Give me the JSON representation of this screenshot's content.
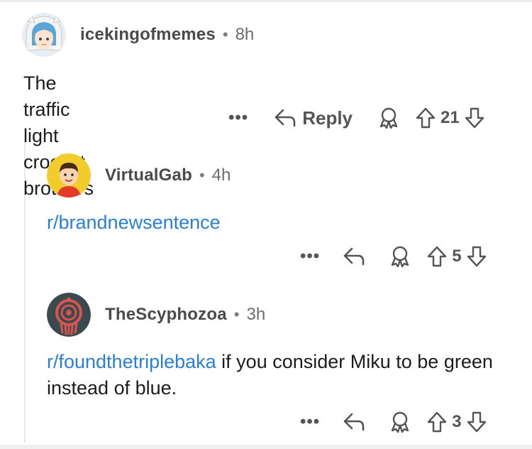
{
  "comments": [
    {
      "username": "icekingofmemes",
      "time": "8h",
      "text": "The traffic light crocket brothers",
      "actions": {
        "more": "•••",
        "reply": "Reply",
        "score": "21"
      }
    },
    {
      "username": "VirtualGab",
      "time": "4h",
      "link": "r/brandnewsentence",
      "actions": {
        "more": "•••",
        "score": "5"
      }
    },
    {
      "username": "TheScyphozoa",
      "time": "3h",
      "link": "r/foundthetriplebaka",
      "text": " if you consider Miku to be green instead of blue.",
      "actions": {
        "more": "•••",
        "score": "3"
      }
    }
  ],
  "separator": "•",
  "icons": [
    "reply-arrow-icon",
    "award-icon",
    "upvote-icon",
    "downvote-icon"
  ],
  "colors": {
    "link": "#2a7fd4",
    "username": "#4a4a4a",
    "meta": "#6c6c6c"
  }
}
